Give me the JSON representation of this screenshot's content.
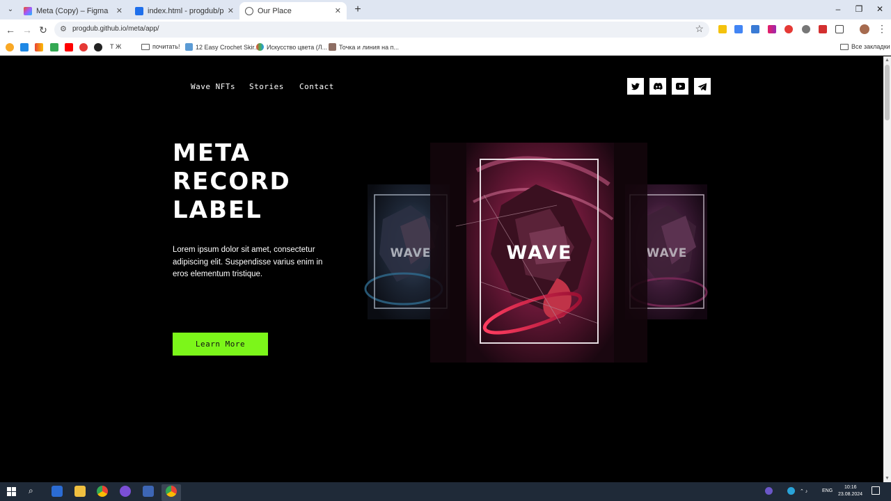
{
  "browser": {
    "tabs": [
      {
        "title": "Meta (Copy) – Figma",
        "active": false
      },
      {
        "title": "index.html - progdub/portfolio",
        "active": false
      },
      {
        "title": "Our Place",
        "active": true
      }
    ],
    "url": "progdub.github.io/meta/app/",
    "bookmarks": [
      "почитать!",
      "12 Easy Crochet Skir...",
      "Искусство цвета (Л...",
      "Точка и линия на п..."
    ],
    "bookmark_short": "Т  Ж",
    "all_bookmarks": "Все закладки"
  },
  "site": {
    "nav": {
      "wave_nfts": "Wave NFTs",
      "stories": "Stories",
      "contact": "Contact"
    },
    "social": [
      "twitter-icon",
      "discord-icon",
      "youtube-icon",
      "telegram-icon"
    ],
    "hero": {
      "title_lines": [
        "META",
        "RECORD",
        "LABEL"
      ],
      "text": "Lorem ipsum dolor sit amet, consectetur adipiscing elit. Suspendisse varius enim in eros elementum tristique.",
      "cta": "Learn More"
    },
    "art": {
      "center_label": "WAVE",
      "side_label": "WAVE"
    },
    "accent": "#7cf61a"
  },
  "taskbar": {
    "lang": "ENG",
    "time": "10:16",
    "date": "23.08.2024"
  }
}
